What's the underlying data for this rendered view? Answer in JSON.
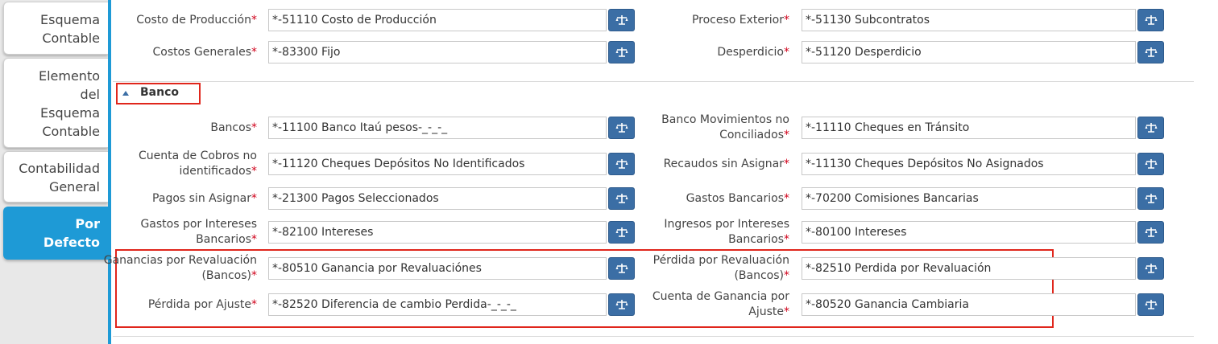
{
  "sidebar": {
    "tabs": [
      {
        "lines": [
          "Esquema",
          "Contable"
        ]
      },
      {
        "lines": [
          "Elemento",
          "del",
          "Esquema",
          "Contable"
        ]
      },
      {
        "lines": [
          "Contabilidad",
          "General"
        ]
      },
      {
        "lines": [
          "Por",
          "Defecto"
        ]
      }
    ]
  },
  "section": {
    "title": "Banco"
  },
  "required_mark": "*",
  "fields": [
    {
      "label_lines": [
        "Costo de Producción"
      ],
      "value": "*-51110 Costo de Producción"
    },
    {
      "label_lines": [
        "Proceso Exterior"
      ],
      "value": "*-51130 Subcontratos"
    },
    {
      "label_lines": [
        "Costos Generales"
      ],
      "value": "*-83300 Fijo"
    },
    {
      "label_lines": [
        "Desperdicio"
      ],
      "value": "*-51120 Desperdicio"
    },
    {
      "label_lines": [
        "Bancos"
      ],
      "value": "*-11100 Banco Itaú pesos-_-_-_"
    },
    {
      "label_lines": [
        "Banco Movimientos no",
        "Conciliados"
      ],
      "value": "*-11110 Cheques en Tránsito"
    },
    {
      "label_lines": [
        "Cuenta de Cobros no",
        "identificados"
      ],
      "value": "*-11120 Cheques Depósitos No Identificados"
    },
    {
      "label_lines": [
        "Recaudos sin Asignar"
      ],
      "value": "*-11130 Cheques Depósitos No Asignados"
    },
    {
      "label_lines": [
        "Pagos sin Asignar"
      ],
      "value": "*-21300 Pagos Seleccionados"
    },
    {
      "label_lines": [
        "Gastos Bancarios"
      ],
      "value": "*-70200 Comisiones Bancarias"
    },
    {
      "label_lines": [
        "Gastos por Intereses",
        "Bancarios"
      ],
      "value": "*-82100 Intereses"
    },
    {
      "label_lines": [
        "Ingresos por Intereses",
        "Bancarios"
      ],
      "value": "*-80100 Intereses"
    },
    {
      "label_lines": [
        "Ganancias por Revaluación",
        "(Bancos)"
      ],
      "value": "*-80510 Ganancia por Revaluaciónes"
    },
    {
      "label_lines": [
        "Pérdida por Revaluación",
        "(Bancos)"
      ],
      "value": "*-82510 Perdida por Revaluación"
    },
    {
      "label_lines": [
        "Pérdida por Ajuste"
      ],
      "value": "*-82520 Diferencia de cambio Perdida-_-_-_"
    },
    {
      "label_lines": [
        "Cuenta de Ganancia por",
        "Ajuste"
      ],
      "value": "*-80520 Ganancia Cambiaria"
    }
  ],
  "colors": {
    "accent": "#1e9ad6",
    "button": "#3b6ea5",
    "required": "#d0021b",
    "highlight": "#e0261c"
  }
}
